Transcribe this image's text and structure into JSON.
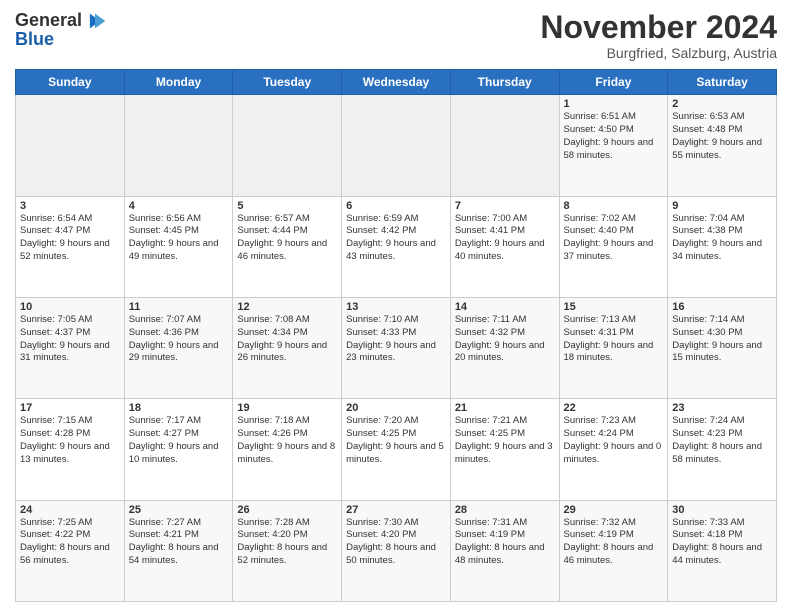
{
  "logo": {
    "line1": "General",
    "line2": "Blue"
  },
  "title": "November 2024",
  "subtitle": "Burgfried, Salzburg, Austria",
  "days_of_week": [
    "Sunday",
    "Monday",
    "Tuesday",
    "Wednesday",
    "Thursday",
    "Friday",
    "Saturday"
  ],
  "weeks": [
    [
      {
        "day": "",
        "info": ""
      },
      {
        "day": "",
        "info": ""
      },
      {
        "day": "",
        "info": ""
      },
      {
        "day": "",
        "info": ""
      },
      {
        "day": "",
        "info": ""
      },
      {
        "day": "1",
        "info": "Sunrise: 6:51 AM\nSunset: 4:50 PM\nDaylight: 9 hours and 58 minutes."
      },
      {
        "day": "2",
        "info": "Sunrise: 6:53 AM\nSunset: 4:48 PM\nDaylight: 9 hours and 55 minutes."
      }
    ],
    [
      {
        "day": "3",
        "info": "Sunrise: 6:54 AM\nSunset: 4:47 PM\nDaylight: 9 hours and 52 minutes."
      },
      {
        "day": "4",
        "info": "Sunrise: 6:56 AM\nSunset: 4:45 PM\nDaylight: 9 hours and 49 minutes."
      },
      {
        "day": "5",
        "info": "Sunrise: 6:57 AM\nSunset: 4:44 PM\nDaylight: 9 hours and 46 minutes."
      },
      {
        "day": "6",
        "info": "Sunrise: 6:59 AM\nSunset: 4:42 PM\nDaylight: 9 hours and 43 minutes."
      },
      {
        "day": "7",
        "info": "Sunrise: 7:00 AM\nSunset: 4:41 PM\nDaylight: 9 hours and 40 minutes."
      },
      {
        "day": "8",
        "info": "Sunrise: 7:02 AM\nSunset: 4:40 PM\nDaylight: 9 hours and 37 minutes."
      },
      {
        "day": "9",
        "info": "Sunrise: 7:04 AM\nSunset: 4:38 PM\nDaylight: 9 hours and 34 minutes."
      }
    ],
    [
      {
        "day": "10",
        "info": "Sunrise: 7:05 AM\nSunset: 4:37 PM\nDaylight: 9 hours and 31 minutes."
      },
      {
        "day": "11",
        "info": "Sunrise: 7:07 AM\nSunset: 4:36 PM\nDaylight: 9 hours and 29 minutes."
      },
      {
        "day": "12",
        "info": "Sunrise: 7:08 AM\nSunset: 4:34 PM\nDaylight: 9 hours and 26 minutes."
      },
      {
        "day": "13",
        "info": "Sunrise: 7:10 AM\nSunset: 4:33 PM\nDaylight: 9 hours and 23 minutes."
      },
      {
        "day": "14",
        "info": "Sunrise: 7:11 AM\nSunset: 4:32 PM\nDaylight: 9 hours and 20 minutes."
      },
      {
        "day": "15",
        "info": "Sunrise: 7:13 AM\nSunset: 4:31 PM\nDaylight: 9 hours and 18 minutes."
      },
      {
        "day": "16",
        "info": "Sunrise: 7:14 AM\nSunset: 4:30 PM\nDaylight: 9 hours and 15 minutes."
      }
    ],
    [
      {
        "day": "17",
        "info": "Sunrise: 7:15 AM\nSunset: 4:28 PM\nDaylight: 9 hours and 13 minutes."
      },
      {
        "day": "18",
        "info": "Sunrise: 7:17 AM\nSunset: 4:27 PM\nDaylight: 9 hours and 10 minutes."
      },
      {
        "day": "19",
        "info": "Sunrise: 7:18 AM\nSunset: 4:26 PM\nDaylight: 9 hours and 8 minutes."
      },
      {
        "day": "20",
        "info": "Sunrise: 7:20 AM\nSunset: 4:25 PM\nDaylight: 9 hours and 5 minutes."
      },
      {
        "day": "21",
        "info": "Sunrise: 7:21 AM\nSunset: 4:25 PM\nDaylight: 9 hours and 3 minutes."
      },
      {
        "day": "22",
        "info": "Sunrise: 7:23 AM\nSunset: 4:24 PM\nDaylight: 9 hours and 0 minutes."
      },
      {
        "day": "23",
        "info": "Sunrise: 7:24 AM\nSunset: 4:23 PM\nDaylight: 8 hours and 58 minutes."
      }
    ],
    [
      {
        "day": "24",
        "info": "Sunrise: 7:25 AM\nSunset: 4:22 PM\nDaylight: 8 hours and 56 minutes."
      },
      {
        "day": "25",
        "info": "Sunrise: 7:27 AM\nSunset: 4:21 PM\nDaylight: 8 hours and 54 minutes."
      },
      {
        "day": "26",
        "info": "Sunrise: 7:28 AM\nSunset: 4:20 PM\nDaylight: 8 hours and 52 minutes."
      },
      {
        "day": "27",
        "info": "Sunrise: 7:30 AM\nSunset: 4:20 PM\nDaylight: 8 hours and 50 minutes."
      },
      {
        "day": "28",
        "info": "Sunrise: 7:31 AM\nSunset: 4:19 PM\nDaylight: 8 hours and 48 minutes."
      },
      {
        "day": "29",
        "info": "Sunrise: 7:32 AM\nSunset: 4:19 PM\nDaylight: 8 hours and 46 minutes."
      },
      {
        "day": "30",
        "info": "Sunrise: 7:33 AM\nSunset: 4:18 PM\nDaylight: 8 hours and 44 minutes."
      }
    ]
  ]
}
